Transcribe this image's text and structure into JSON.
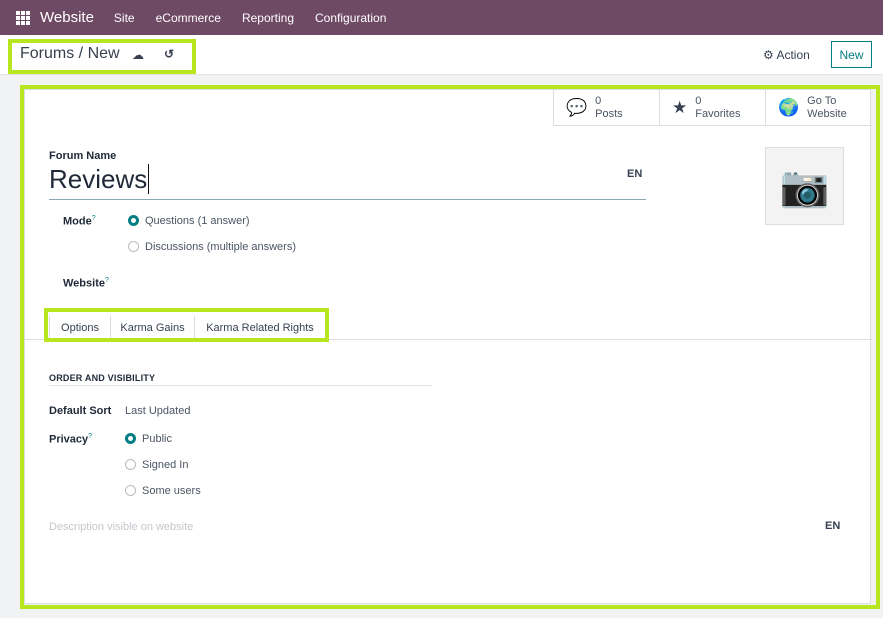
{
  "navbar": {
    "brand": "Website",
    "menu": [
      "Site",
      "eCommerce",
      "Reporting",
      "Configuration"
    ]
  },
  "control_panel": {
    "breadcrumb": "Forums / New",
    "action_label": "Action",
    "new_label": "New"
  },
  "stats": [
    {
      "value": "0",
      "label": "Posts",
      "icon": "comments-icon"
    },
    {
      "value": "0",
      "label": "Favorites",
      "icon": "star-icon"
    },
    {
      "value": "Go To",
      "label": "Website",
      "icon": "globe-icon"
    }
  ],
  "form": {
    "name_label": "Forum Name",
    "name_value": "Reviews",
    "lang": "EN",
    "mode_label": "Mode",
    "mode_options": [
      "Questions (1 answer)",
      "Discussions (multiple answers)"
    ],
    "mode_selected": 0,
    "website_label": "Website",
    "help": "?"
  },
  "tabs": [
    "Options",
    "Karma Gains",
    "Karma Related Rights"
  ],
  "options": {
    "section": "ORDER AND VISIBILITY",
    "sort_label": "Default Sort",
    "sort_value": "Last Updated",
    "privacy_label": "Privacy",
    "privacy_options": [
      "Public",
      "Signed In",
      "Some users"
    ],
    "privacy_selected": 0,
    "description_placeholder": "Description visible on website",
    "lang": "EN"
  },
  "colors": {
    "navbar": "#6f4a65",
    "accent": "#017e84",
    "highlight": "#b7e51e"
  }
}
